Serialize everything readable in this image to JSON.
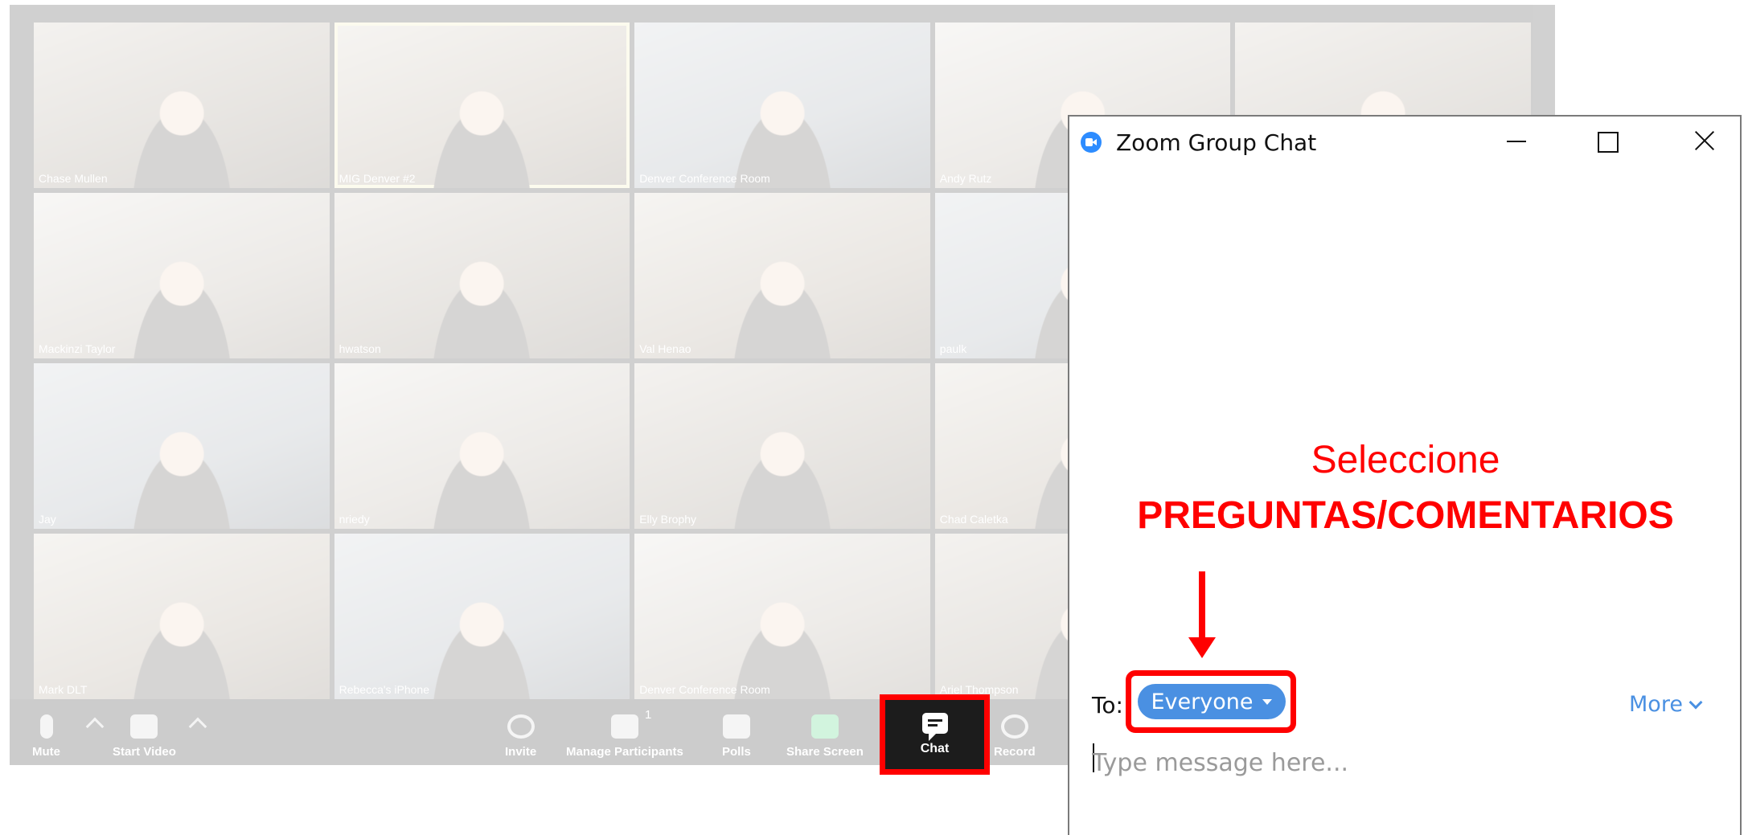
{
  "meeting": {
    "participants": [
      "Chase Mullen",
      "MIG Denver #2",
      "Denver Conference Room",
      "Andy Rutz",
      "",
      "Mackinzi Taylor",
      "hwatson",
      "Val Henao",
      "paulk",
      "",
      "Jay",
      "nriedy",
      "Elly Brophy",
      "Chad Caletka",
      "",
      "Mark DLT",
      "Rebecca's iPhone",
      "Denver Conference Room",
      "Ariel Thompson",
      ""
    ],
    "toolbar": {
      "mute": "Mute",
      "start_video": "Start Video",
      "invite": "Invite",
      "manage_participants": "Manage Participants",
      "participant_count": "1",
      "polls": "Polls",
      "share_screen": "Share Screen",
      "chat": "Chat",
      "record": "Record"
    }
  },
  "chat_window": {
    "title": "Zoom Group Chat",
    "to_label": "To:",
    "recipient": "Everyone",
    "more": "More",
    "input_placeholder": "Type message here..."
  },
  "annotation": {
    "line1": "Seleccione",
    "line2": "PREGUNTAS/COMENTARIOS",
    "color": "#ff0000"
  },
  "colors": {
    "zoom_blue": "#2d8cff",
    "recipient_pill": "#4a90e2",
    "highlight": "#ff0000",
    "toolbar": "#1a1a1a"
  }
}
